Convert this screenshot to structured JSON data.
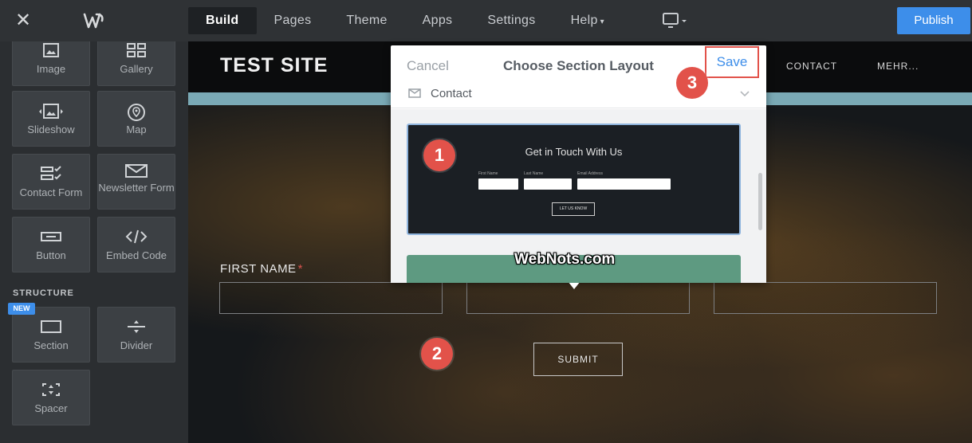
{
  "topbar": {
    "tabs": [
      {
        "label": "Build",
        "active": true
      },
      {
        "label": "Pages"
      },
      {
        "label": "Theme"
      },
      {
        "label": "Apps"
      },
      {
        "label": "Settings"
      },
      {
        "label": "Help",
        "dropdown": true
      }
    ],
    "publish_label": "Publish",
    "close_icon": "close-icon",
    "logo_icon": "weebly-logo",
    "device_icon": "desktop-device-icon"
  },
  "sidebar": {
    "tiles": [
      {
        "label": "Image",
        "icon": "image-icon"
      },
      {
        "label": "Gallery",
        "icon": "gallery-icon"
      },
      {
        "label": "Slideshow",
        "icon": "slideshow-icon"
      },
      {
        "label": "Map",
        "icon": "map-pin-icon"
      },
      {
        "label": "Contact Form",
        "icon": "contact-form-icon"
      },
      {
        "label": "Newsletter Form",
        "icon": "envelope-icon"
      },
      {
        "label": "Button",
        "icon": "button-icon"
      },
      {
        "label": "Embed Code",
        "icon": "code-icon"
      }
    ],
    "structure_heading": "STRUCTURE",
    "new_badge": "NEW",
    "structure_tiles": [
      {
        "label": "Section",
        "icon": "section-icon"
      },
      {
        "label": "Divider",
        "icon": "divider-icon"
      },
      {
        "label": "Spacer",
        "icon": "spacer-icon"
      }
    ]
  },
  "site": {
    "title": "TEST SITE",
    "nav": [
      "CONTACT",
      "MEHR..."
    ],
    "form": {
      "first_name_label": "FIRST NAME",
      "required_mark": "*",
      "submit_label": "SUBMIT"
    }
  },
  "modal": {
    "cancel_label": "Cancel",
    "title": "Choose Section Layout",
    "save_label": "Save",
    "category": "Contact",
    "preview": {
      "heading": "Get in Touch With Us",
      "field_labels": [
        "First Name",
        "Last Name",
        "Email Address"
      ],
      "button_label": "LET US KNOW"
    }
  },
  "watermark": "WebNots.com",
  "annotations": [
    "1",
    "2",
    "3"
  ],
  "colors": {
    "accent": "#3d8eea",
    "annotation": "#e2524a",
    "strip": "#7aa9b5",
    "alt_layout": "#5e9a81"
  }
}
